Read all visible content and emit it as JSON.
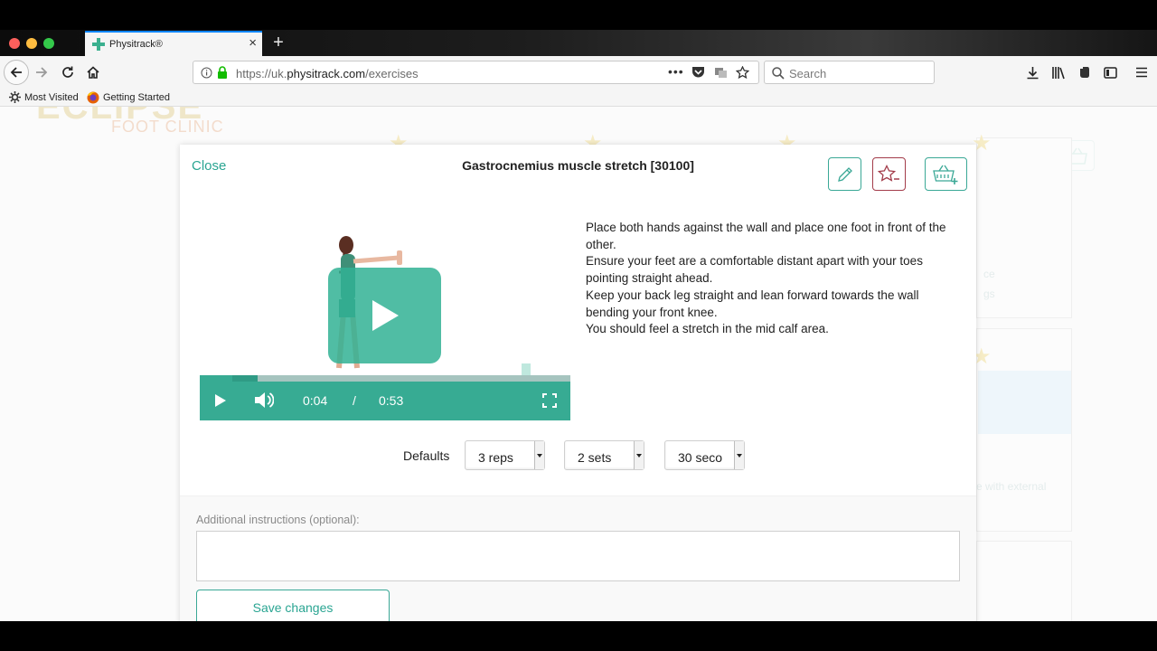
{
  "browser": {
    "tab_title": "Physitrack®",
    "url_prefix": "https://uk.",
    "url_domain": "physitrack.com",
    "url_path": "/exercises",
    "search_placeholder": "Search",
    "bookmarks": [
      "Most Visited",
      "Getting Started"
    ]
  },
  "background": {
    "logo_main": "ECLIPSE",
    "logo_sub": "FOOT CLINIC",
    "basket_count": "0",
    "snippets": [
      "ce",
      "gs",
      "e with external"
    ]
  },
  "modal": {
    "close_label": "Close",
    "title": "Gastrocnemius muscle stretch [30100]",
    "video": {
      "current_time": "0:04",
      "separator": "/",
      "duration": "0:53",
      "progress_fraction": 0.075
    },
    "description": [
      "Place both hands against the wall and place one foot in front of the other.",
      "Ensure your feet are a comfortable distant apart with your toes pointing straight ahead.",
      "Keep your back leg straight and lean forward towards the wall bending your front knee.",
      "You should feel a stretch in the mid calf area."
    ],
    "defaults_label": "Defaults",
    "defaults": {
      "reps": "3 reps",
      "sets": "2 sets",
      "hold": "30 seco"
    },
    "instructions_label": "Additional instructions (optional):",
    "instructions_value": "",
    "save_label": "Save changes"
  },
  "colors": {
    "accent": "#37ab93",
    "danger": "#a33c4a"
  }
}
